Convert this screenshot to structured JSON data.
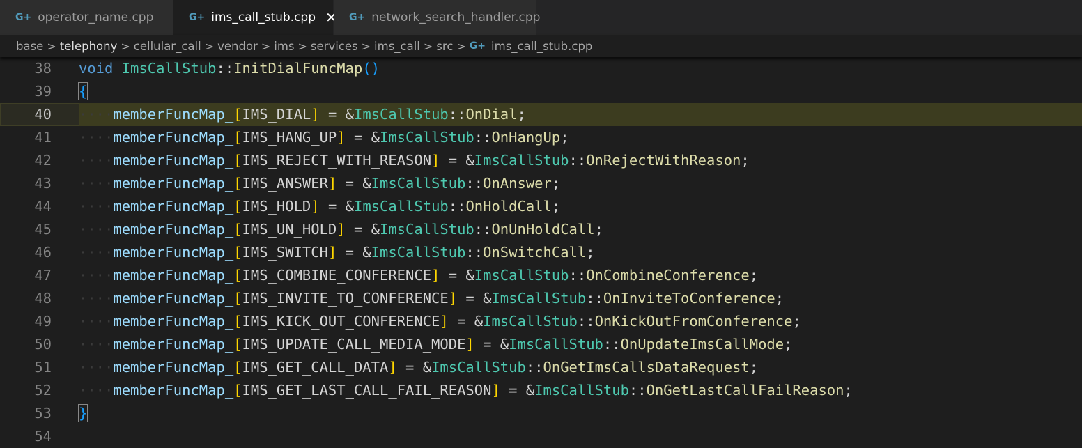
{
  "tabs": [
    {
      "label": "operator_name.cpp",
      "icon": "cpp-file-icon",
      "active": false
    },
    {
      "label": "ims_call_stub.cpp",
      "icon": "cpp-file-icon",
      "active": true,
      "close": "✕"
    },
    {
      "label": "network_search_handler.cpp",
      "icon": "cpp-file-icon",
      "active": false
    }
  ],
  "file_icon_glyph": "G+",
  "breadcrumb": [
    "base",
    "telephony",
    "cellular_call",
    "vendor",
    "ims",
    "services",
    "ims_call",
    "src",
    "ims_call_stub.cpp"
  ],
  "breadcrumb_separator": ">",
  "editor": {
    "current_line": 40,
    "lines": [
      {
        "n": "38",
        "kind": "signature",
        "kw": "void",
        "cls": "ImsCallStub",
        "scope": "::",
        "fn": "InitDialFuncMap",
        "tail": "()"
      },
      {
        "n": "39",
        "kind": "open",
        "text": "{"
      },
      {
        "n": "40",
        "kind": "entry",
        "var": "memberFuncMap_",
        "key": "IMS_DIAL",
        "cls": "ImsCallStub",
        "handler": "OnDial"
      },
      {
        "n": "41",
        "kind": "entry",
        "var": "memberFuncMap_",
        "key": "IMS_HANG_UP",
        "cls": "ImsCallStub",
        "handler": "OnHangUp"
      },
      {
        "n": "42",
        "kind": "entry",
        "var": "memberFuncMap_",
        "key": "IMS_REJECT_WITH_REASON",
        "cls": "ImsCallStub",
        "handler": "OnRejectWithReason"
      },
      {
        "n": "43",
        "kind": "entry",
        "var": "memberFuncMap_",
        "key": "IMS_ANSWER",
        "cls": "ImsCallStub",
        "handler": "OnAnswer"
      },
      {
        "n": "44",
        "kind": "entry",
        "var": "memberFuncMap_",
        "key": "IMS_HOLD",
        "cls": "ImsCallStub",
        "handler": "OnHoldCall"
      },
      {
        "n": "45",
        "kind": "entry",
        "var": "memberFuncMap_",
        "key": "IMS_UN_HOLD",
        "cls": "ImsCallStub",
        "handler": "OnUnHoldCall"
      },
      {
        "n": "46",
        "kind": "entry",
        "var": "memberFuncMap_",
        "key": "IMS_SWITCH",
        "cls": "ImsCallStub",
        "handler": "OnSwitchCall"
      },
      {
        "n": "47",
        "kind": "entry",
        "var": "memberFuncMap_",
        "key": "IMS_COMBINE_CONFERENCE",
        "cls": "ImsCallStub",
        "handler": "OnCombineConference"
      },
      {
        "n": "48",
        "kind": "entry",
        "var": "memberFuncMap_",
        "key": "IMS_INVITE_TO_CONFERENCE",
        "cls": "ImsCallStub",
        "handler": "OnInviteToConference"
      },
      {
        "n": "49",
        "kind": "entry",
        "var": "memberFuncMap_",
        "key": "IMS_KICK_OUT_CONFERENCE",
        "cls": "ImsCallStub",
        "handler": "OnKickOutFromConference"
      },
      {
        "n": "50",
        "kind": "entry",
        "var": "memberFuncMap_",
        "key": "IMS_UPDATE_CALL_MEDIA_MODE",
        "cls": "ImsCallStub",
        "handler": "OnUpdateImsCallMode"
      },
      {
        "n": "51",
        "kind": "entry",
        "var": "memberFuncMap_",
        "key": "IMS_GET_CALL_DATA",
        "cls": "ImsCallStub",
        "handler": "OnGetImsCallsDataRequest"
      },
      {
        "n": "52",
        "kind": "entry",
        "var": "memberFuncMap_",
        "key": "IMS_GET_LAST_CALL_FAIL_REASON",
        "cls": "ImsCallStub",
        "handler": "OnGetLastCallFailReason"
      },
      {
        "n": "53",
        "kind": "close",
        "text": "}"
      },
      {
        "n": "54",
        "kind": "empty"
      }
    ]
  },
  "colors": {
    "keyword": "#569cd6",
    "type": "#4ec9b0",
    "function": "#dcdcaa",
    "variable": "#9cdcfe",
    "bracket_level1": "#ffd700",
    "bracket_level2": "#179fff",
    "icon_cpp": "#519aba"
  }
}
